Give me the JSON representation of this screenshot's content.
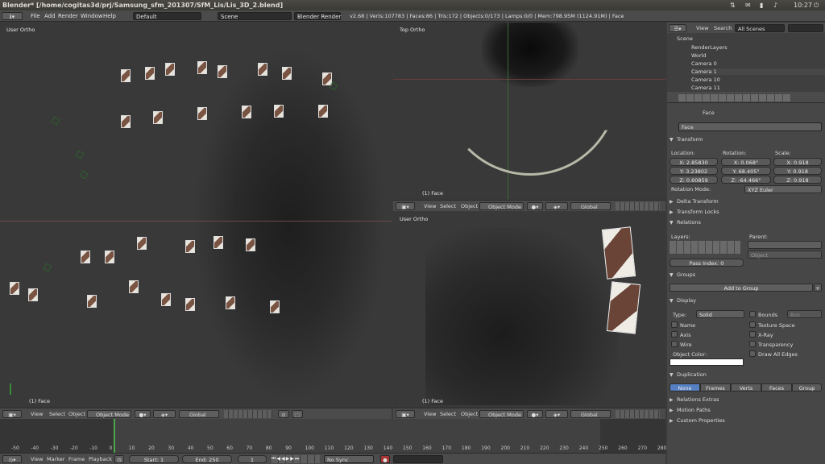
{
  "title": "Blender* [/home/cogitas3d/prj/Samsung_sfm_201307/SfM_Lis/Lis_3D_2.blend]",
  "clock": "10:27",
  "menu": [
    "File",
    "Add",
    "Render",
    "Window",
    "Help"
  ],
  "layout": "Default",
  "scene": "Scene",
  "engine": "Blender Render",
  "stats": "v2.68 | Verts:107783 | Faces:86 | Tris:172 | Objects:0/173 | Lamps:0/0 | Mem:798.95M (1124.91M) | Face",
  "views": {
    "left": "User Ortho",
    "top_right": "Top Ortho",
    "bottom_right": "User Ortho",
    "obj": "(1) Face"
  },
  "header": {
    "view": "View",
    "select": "Select",
    "object": "Object",
    "mode": "Object Mode",
    "orient": "Global"
  },
  "outliner": {
    "view": "View",
    "search": "Search",
    "filter": "All Scenes",
    "items": [
      "Scene",
      "RenderLayers",
      "World",
      "Camera 0",
      "Camera 1",
      "Camera 10",
      "Camera 11"
    ]
  },
  "props": {
    "object": "Face",
    "name": "Face",
    "transform": "Transform",
    "location": "Location:",
    "rotation": "Rotation:",
    "scale": "Scale:",
    "loc": [
      "X: 2.85830",
      "Y: 3.23802",
      "Z: 0.60859"
    ],
    "rot": [
      "X: 0.068°",
      "Y: 68.405°",
      "Z: -64.466°"
    ],
    "scl": [
      "X: 0.918",
      "Y: 0.918",
      "Z: 0.918"
    ],
    "rot_mode_label": "Rotation Mode:",
    "rot_mode": "XYZ Euler",
    "delta": "Delta Transform",
    "locks": "Transform Locks",
    "relations": "Relations",
    "layers": "Layers:",
    "parent": "Parent:",
    "pass": "Pass Index: 0",
    "parent_type": "Object",
    "groups": "Groups",
    "add_group": "Add to Group",
    "display": "Display",
    "type_label": "Type:",
    "type": "Solid",
    "bounds": "Bounds",
    "box": "Box",
    "checks_left": [
      "Name",
      "Axis",
      "Wire"
    ],
    "checks_right": [
      "Texture Space",
      "X-Ray",
      "Transparency",
      "Draw All Edges"
    ],
    "obj_color": "Object Color:",
    "dup": "Duplication",
    "dup_opts": [
      "None",
      "Frames",
      "Verts",
      "Faces",
      "Group"
    ],
    "collapsed": [
      "Relations Extras",
      "Motion Paths",
      "Custom Properties"
    ]
  },
  "timeline": {
    "view": "View",
    "marker": "Marker",
    "frame": "Frame",
    "playback": "Playback",
    "start": "Start: 1",
    "end": "End: 250",
    "cur": "1",
    "sync": "No Sync",
    "ticks": [
      "-50",
      "-40",
      "-30",
      "-20",
      "-10",
      "0",
      "10",
      "20",
      "30",
      "40",
      "50",
      "60",
      "70",
      "80",
      "90",
      "100",
      "110",
      "120",
      "130",
      "140",
      "150",
      "160",
      "170",
      "180",
      "190",
      "200",
      "210",
      "220",
      "230",
      "240",
      "250",
      "260",
      "270",
      "280"
    ]
  }
}
